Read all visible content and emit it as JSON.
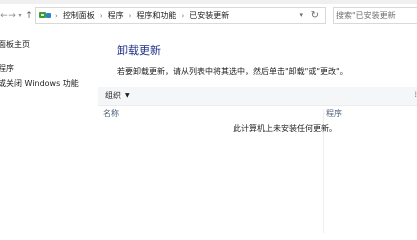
{
  "address_bar": {
    "path": [
      "控制面板",
      "程序",
      "程序和功能",
      "已安装更新"
    ]
  },
  "search": {
    "placeholder": "搜索\"已安装更新"
  },
  "sidebar": {
    "items": [
      {
        "label": "面板主页"
      },
      {
        "label": "程序"
      },
      {
        "label": "或关闭 Windows 功能"
      }
    ]
  },
  "main": {
    "title": "卸载更新",
    "description": "若要卸载更新，请从列表中将其选中，然后单击\"卸载\"或\"更改\"。"
  },
  "toolbar": {
    "organize_label": "组织"
  },
  "table": {
    "columns": [
      "名称",
      "程序"
    ],
    "empty_message": "此计算机上未安装任何更新。"
  },
  "icons": {
    "back": "back-arrow-icon",
    "forward": "forward-arrow-icon",
    "recent": "recent-locations-icon",
    "up": "up-arrow-icon",
    "control_panel": "control-panel-icon",
    "refresh": "refresh-icon",
    "search": "search-icon"
  },
  "colors": {
    "title": "#1e3287",
    "column_header": "#4c607a",
    "toolbar_bg": "#f5f6f7"
  }
}
